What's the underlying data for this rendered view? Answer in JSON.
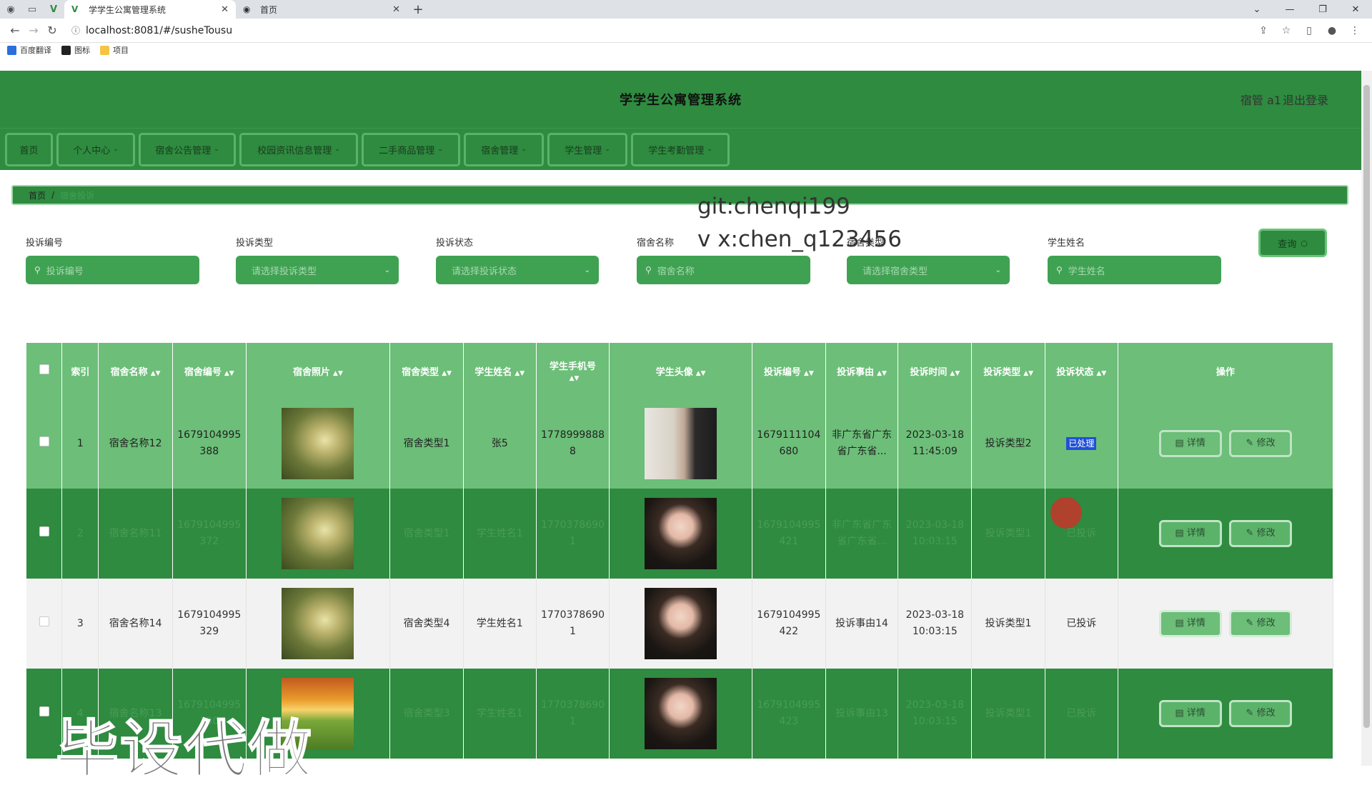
{
  "browser": {
    "tabs": [
      {
        "title": "学学生公寓管理系统",
        "active": true
      },
      {
        "title": "首页",
        "active": false
      }
    ],
    "url": "localhost:8081/#/susheTousu",
    "bookmarks": [
      "百度翻译",
      "图标",
      "项目"
    ]
  },
  "app": {
    "title": "学学生公寓管理系统",
    "user": "宿管 a1",
    "logout": "退出登录",
    "menu": [
      {
        "label": "首页",
        "dropdown": false
      },
      {
        "label": "个人中心",
        "dropdown": true
      },
      {
        "label": "宿舍公告管理",
        "dropdown": true
      },
      {
        "label": "校园资讯信息管理",
        "dropdown": true
      },
      {
        "label": "二手商品管理",
        "dropdown": true
      },
      {
        "label": "宿舍管理",
        "dropdown": true
      },
      {
        "label": "学生管理",
        "dropdown": true
      },
      {
        "label": "学生考勤管理",
        "dropdown": true
      }
    ],
    "breadcrumb": {
      "home": "首页",
      "separator": "/",
      "current": "宿舍投诉"
    },
    "watermark": {
      "line1": "git:chenqi199",
      "line2": "v x:chen_q123456",
      "big": "毕设代做"
    }
  },
  "filters": [
    {
      "label": "投诉编号",
      "placeholder": "投诉编号",
      "type": "input"
    },
    {
      "label": "投诉类型",
      "placeholder": "请选择投诉类型",
      "type": "select"
    },
    {
      "label": "投诉状态",
      "placeholder": "请选择投诉状态",
      "type": "select"
    },
    {
      "label": "宿舍名称",
      "placeholder": "宿舍名称",
      "type": "input"
    },
    {
      "label": "宿舍类型",
      "placeholder": "请选择宿舍类型",
      "type": "select"
    },
    {
      "label": "学生姓名",
      "placeholder": "学生姓名",
      "type": "input"
    }
  ],
  "query_button": "查询",
  "table": {
    "headers": [
      "索引",
      "宿舍名称",
      "宿舍编号",
      "宿舍照片",
      "宿舍类型",
      "学生姓名",
      "学生手机号",
      "学生头像",
      "投诉编号",
      "投诉事由",
      "投诉时间",
      "投诉类型",
      "投诉状态",
      "操作"
    ],
    "rows": [
      {
        "index": "1",
        "name": "宿舍名称12",
        "no": "1679104995388",
        "photo": "forest",
        "type": "宿舍类型1",
        "student": "张5",
        "phone": "17789998888",
        "avatar": "man",
        "tno": "1679111104680",
        "reason": "非广东省广东省广东省...",
        "time": "2023-03-18 11:45:09",
        "ttype": "投诉类型2",
        "status": "已处理"
      },
      {
        "index": "2",
        "name": "宿舍名称11",
        "no": "1679104995372",
        "photo": "forest",
        "type": "宿舍类型1",
        "student": "学生姓名1",
        "phone": "17703786901",
        "avatar": "girl",
        "tno": "1679104995421",
        "reason": "非广东省广东省广东省...",
        "time": "2023-03-18 10:03:15",
        "ttype": "投诉类型1",
        "status": "已投诉"
      },
      {
        "index": "3",
        "name": "宿舍名称14",
        "no": "1679104995329",
        "photo": "forest",
        "type": "宿舍类型4",
        "student": "学生姓名1",
        "phone": "17703786901",
        "avatar": "girl",
        "tno": "1679104995422",
        "reason": "投诉事由14",
        "time": "2023-03-18 10:03:15",
        "ttype": "投诉类型1",
        "status": "已投诉"
      },
      {
        "index": "4",
        "name": "宿舍名称13",
        "no": "1679104995330",
        "photo": "sunset",
        "type": "宿舍类型3",
        "student": "学生姓名1",
        "phone": "17703786901",
        "avatar": "girl",
        "tno": "1679104995423",
        "reason": "投诉事由13",
        "time": "2023-03-18 10:03:15",
        "ttype": "投诉类型1",
        "status": "已投诉"
      }
    ],
    "actions": {
      "detail": "详情",
      "edit": "修改"
    }
  }
}
